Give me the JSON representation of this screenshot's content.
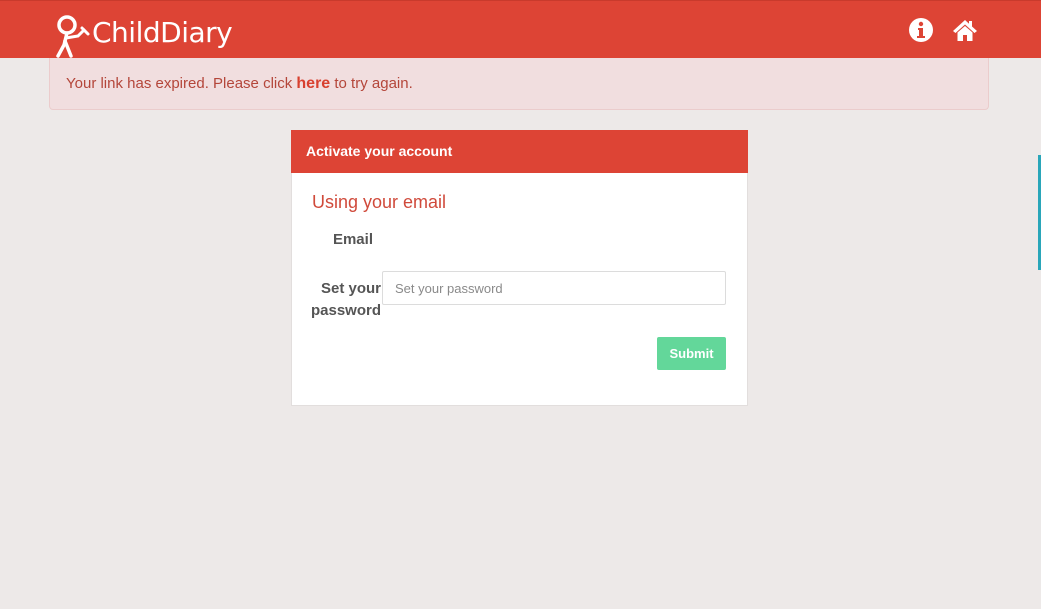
{
  "header": {
    "logo_text": "ChildDiary",
    "info_icon": "info-circle-icon",
    "home_icon": "home-icon",
    "brand_color": "#dd4435"
  },
  "alert": {
    "text_before": "Your link has expired. Please click ",
    "link_text": "here",
    "text_after": " to try again."
  },
  "panel": {
    "heading": "Activate your account",
    "section_title": "Using your email",
    "email_label": "Email",
    "password_label": "Set your password",
    "password_placeholder": "Set your password",
    "password_value": "",
    "submit_label": "Submit"
  }
}
